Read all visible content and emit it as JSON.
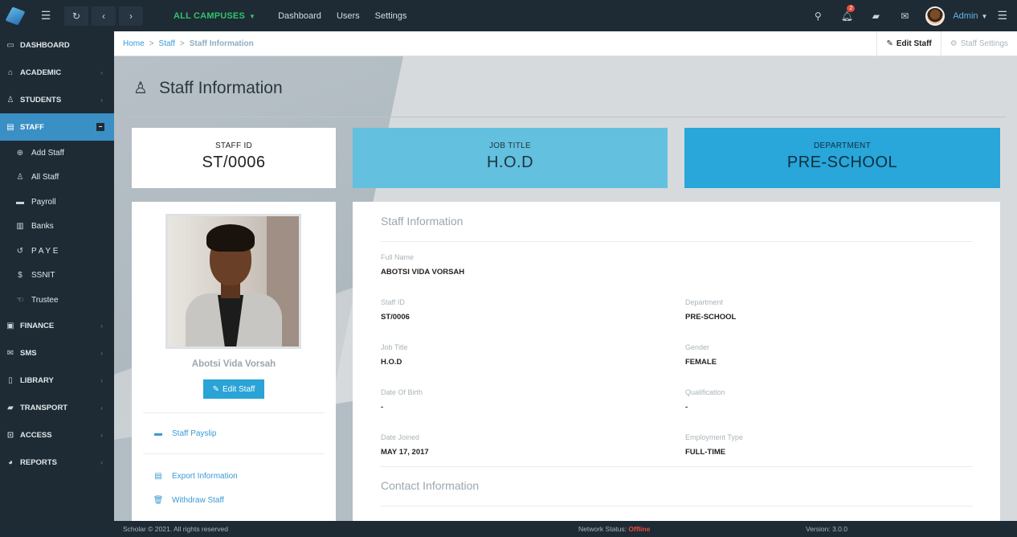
{
  "topbar": {
    "campus": "ALL CAMPUSES",
    "nav": [
      "Dashboard",
      "Users",
      "Settings"
    ],
    "notifications_count": "2",
    "user": "Admin"
  },
  "sidebar": {
    "items": [
      {
        "label": "DASHBOARD",
        "icon": "monitor-icon"
      },
      {
        "label": "ACADEMIC",
        "icon": "graduation-cap-icon"
      },
      {
        "label": "STUDENTS",
        "icon": "user-icon"
      },
      {
        "label": "STAFF",
        "icon": "staff-icon"
      },
      {
        "label": "FINANCE",
        "icon": "money-icon"
      },
      {
        "label": "SMS",
        "icon": "envelope-icon"
      },
      {
        "label": "LIBRARY",
        "icon": "book-icon"
      },
      {
        "label": "TRANSPORT",
        "icon": "truck-icon"
      },
      {
        "label": "ACCESS",
        "icon": "lock-icon"
      },
      {
        "label": "REPORTS",
        "icon": "pie-chart-icon"
      }
    ],
    "staff_sub": [
      {
        "label": "Add Staff",
        "icon": "plus-circle-icon"
      },
      {
        "label": "All Staff",
        "icon": "users-icon"
      },
      {
        "label": "Payroll",
        "icon": "card-icon"
      },
      {
        "label": "Banks",
        "icon": "bank-icon"
      },
      {
        "label": "P A Y E",
        "icon": "history-icon"
      },
      {
        "label": "SSNIT",
        "icon": "dollar-icon"
      },
      {
        "label": "Trustee",
        "icon": "handshake-icon"
      }
    ]
  },
  "breadcrumb": {
    "home": "Home",
    "staff": "Staff",
    "current": "Staff Information",
    "edit": "Edit Staff",
    "settings": "Staff Settings"
  },
  "page": {
    "title": "Staff Information"
  },
  "cards": {
    "staff_id_label": "STAFF ID",
    "staff_id": "ST/0006",
    "job_title_label": "JOB TITLE",
    "job_title": "H.O.D",
    "department_label": "DEPARTMENT",
    "department": "PRE-SCHOOL"
  },
  "profile": {
    "name": "Abotsi Vida Vorsah",
    "edit": "Edit Staff",
    "links": [
      "Staff Payslip",
      "Export Information",
      "Withdraw Staff"
    ]
  },
  "info": {
    "section1": "Staff Information",
    "section2": "Contact Information",
    "full_name_label": "Full Name",
    "full_name": "ABOTSI VIDA VORSAH",
    "staff_id_label": "Staff ID",
    "staff_id": "ST/0006",
    "department_label": "Department",
    "department": "PRE-SCHOOL",
    "job_title_label": "Job Title",
    "job_title": "H.O.D",
    "gender_label": "Gender",
    "gender": "FEMALE",
    "dob_label": "Date Of Birth",
    "dob": "-",
    "qualification_label": "Qualification",
    "qualification": "-",
    "date_joined_label": "Date Joined",
    "date_joined": "MAY 17, 2017",
    "employment_type_label": "Employment Type",
    "employment_type": "FULL-TIME"
  },
  "footer": {
    "copyright": "Scholar © 2021. All rights reserved",
    "network_label": "Network Status:",
    "network_value": "Offline",
    "version": "Version: 3.0.0"
  }
}
